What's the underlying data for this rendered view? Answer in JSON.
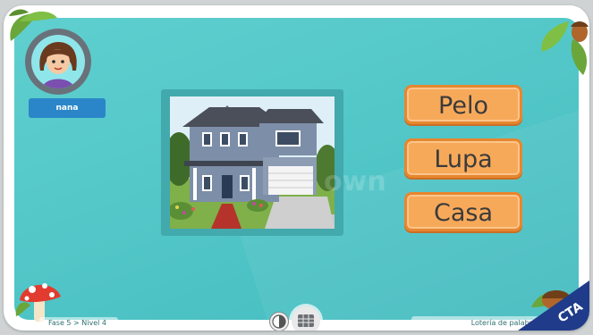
{
  "user": {
    "name": "nana"
  },
  "options": [
    {
      "label": "Pelo"
    },
    {
      "label": "Lupa"
    },
    {
      "label": "Casa"
    }
  ],
  "watermark_text": "own",
  "footer": {
    "level_text": "Fase 5 > Nivel 4",
    "game_name": "Lotería de palabras"
  },
  "corner_badge": "CTA",
  "colors": {
    "background": "#4fc4c6",
    "option_fill": "#f7a95a",
    "option_border": "#e7862f",
    "name_badge": "#2a86c8",
    "cta": "#1f3b8a"
  },
  "icons": [
    "avatar-girl",
    "leaves-top-left",
    "leaves-top-right",
    "mushroom-icon",
    "acorn-icon",
    "toggle-icon",
    "grid-icon"
  ]
}
